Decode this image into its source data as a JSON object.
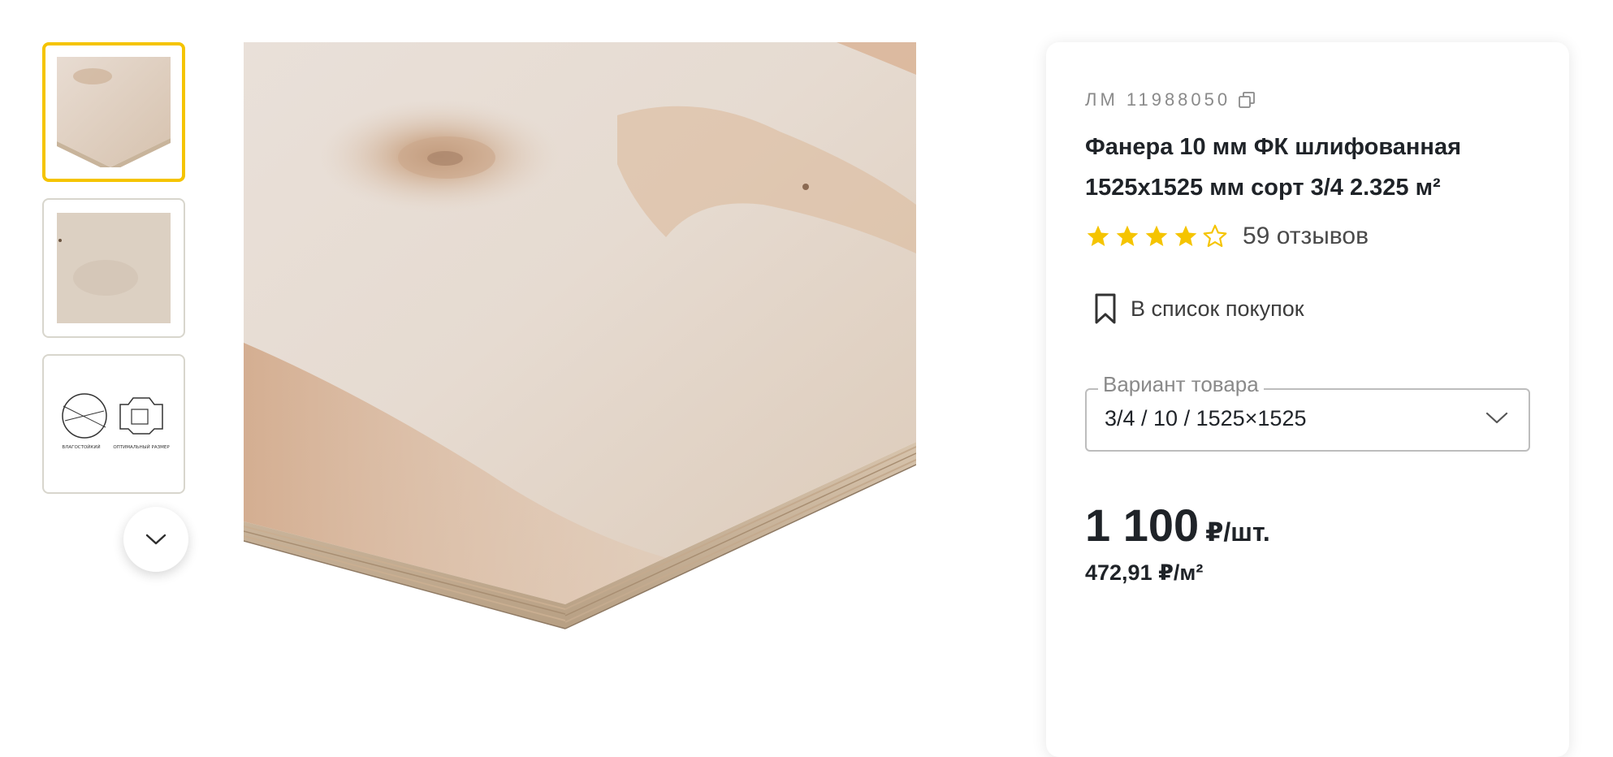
{
  "product": {
    "sku": "ЛМ 11988050",
    "title_line1": "Фанера 10 мм ФК шлифованная",
    "title_line2": "1525x1525 мм сорт 3/4 2.325 м²",
    "rating": 4,
    "rating_max": 5,
    "reviews": "59 отзывов",
    "shopping_list_label": "В список покупок",
    "variant": {
      "legend": "Вариант товара",
      "value": "3/4 / 10 / 1525×1525"
    },
    "price": {
      "value": "1 100",
      "unit": "₽/шт.",
      "per_unit": "472,91 ₽/м²"
    }
  },
  "gallery": {
    "thumbnails": [
      {
        "name": "plywood-corner",
        "active": true
      },
      {
        "name": "plywood-surface",
        "active": false
      },
      {
        "name": "plywood-diagrams",
        "active": false,
        "captions": [
          "ВЛАГОСТОЙКИЙ",
          "ОПТИМАЛЬНЫЙ РАЗМЕР"
        ]
      }
    ]
  },
  "colors": {
    "accent": "#f5c400",
    "text": "#1f2328",
    "muted": "#8a8a8a"
  }
}
